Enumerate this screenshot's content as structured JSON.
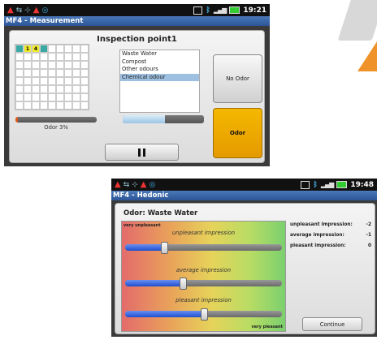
{
  "screen1": {
    "status_time": "19:21",
    "title": "MF4 - Measurement",
    "inspection_title": "Inspection point1",
    "grid": {
      "columns": 9,
      "rows": 8,
      "marked_cells": [
        {
          "index": 0,
          "color": "#3aa9a4",
          "label": ""
        },
        {
          "index": 1,
          "color": "#f1ec27",
          "label": "1"
        },
        {
          "index": 2,
          "color": "#f1ec27",
          "label": "4"
        },
        {
          "index": 3,
          "color": "#3aa9a4",
          "label": ""
        }
      ]
    },
    "odour_options": [
      "Waste Water",
      "Compost",
      "Other odours",
      "Chemical odour"
    ],
    "selected_option": "Chemical odour",
    "no_odor_label": "No Odor",
    "odor_label": "Odor",
    "odor_percent_text": "Odor 3%",
    "odor_progress": 0.03,
    "secondary_progress": 0.52,
    "pause_button": "pause-icon"
  },
  "screen2": {
    "status_time": "19:48",
    "title": "MF4 - Hedonic",
    "odor_heading": "Odor:  Waste Water",
    "label_very_unpleasant": "very unpleasant",
    "label_very_pleasant": "very pleasant",
    "sliders": [
      {
        "label": "unpleasant impression",
        "value": 0.25
      },
      {
        "label": "average impression",
        "value": 0.37
      },
      {
        "label": "pleasant impression",
        "value": 0.5
      }
    ],
    "scores": [
      {
        "label": "unpleasant impression:",
        "value": "-2"
      },
      {
        "label": "average impression:",
        "value": "-1"
      },
      {
        "label": "pleasant impression:",
        "value": "0"
      }
    ],
    "continue_label": "Continue"
  },
  "colors": {
    "odor_button": "#f0a800",
    "title_bar": "#2b5496",
    "slider_fill": "#1f4fd0",
    "progress_fill": "#e05a18"
  }
}
